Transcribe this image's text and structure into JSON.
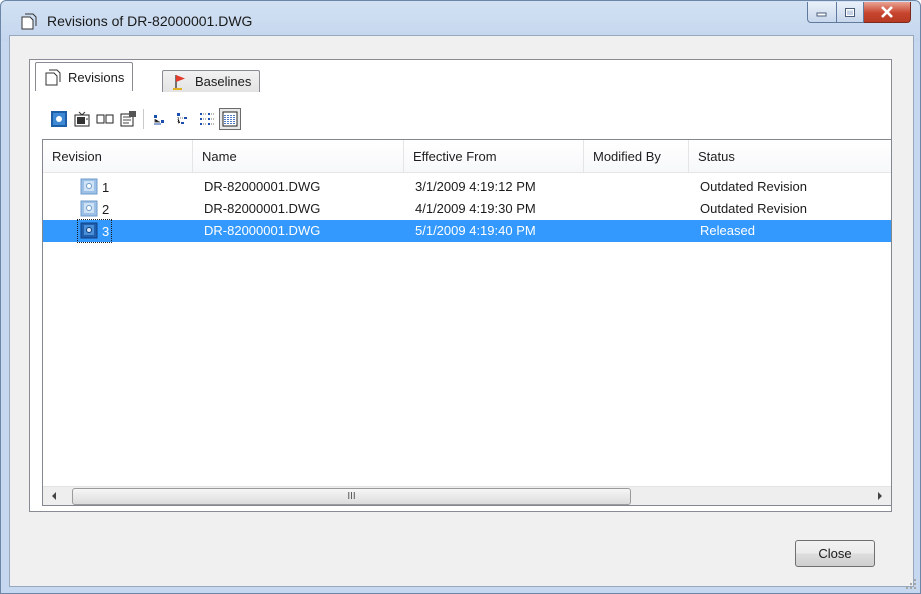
{
  "window": {
    "title": "Revisions of DR-82000001.DWG"
  },
  "tabs": [
    {
      "label": "Revisions",
      "active": true
    },
    {
      "label": "Baselines",
      "active": false
    }
  ],
  "toolbar": {
    "icons": [
      "view-icon",
      "tv-icon",
      "columns-icon",
      "properties-icon",
      "tree-collapsed-icon",
      "tree-expanded-icon",
      "details-view-icon",
      "list-view-icon"
    ]
  },
  "list": {
    "columns": [
      "Revision",
      "Name",
      "Effective From",
      "Modified By",
      "Status"
    ],
    "rows": [
      {
        "revision": "1",
        "name": "DR-82000001.DWG",
        "effective_from": "3/1/2009 4:19:12 PM",
        "modified_by": "",
        "status": "Outdated Revision",
        "selected": false
      },
      {
        "revision": "2",
        "name": "DR-82000001.DWG",
        "effective_from": "4/1/2009 4:19:30 PM",
        "modified_by": "",
        "status": "Outdated Revision",
        "selected": false
      },
      {
        "revision": "3",
        "name": "DR-82000001.DWG",
        "effective_from": "5/1/2009 4:19:40 PM",
        "modified_by": "",
        "status": "Released",
        "selected": true
      }
    ],
    "scrollbar_thumb_glyph": "III"
  },
  "buttons": {
    "close_label": "Close"
  },
  "colors": {
    "selection": "#3399ff",
    "close_button": "#c7452e"
  }
}
